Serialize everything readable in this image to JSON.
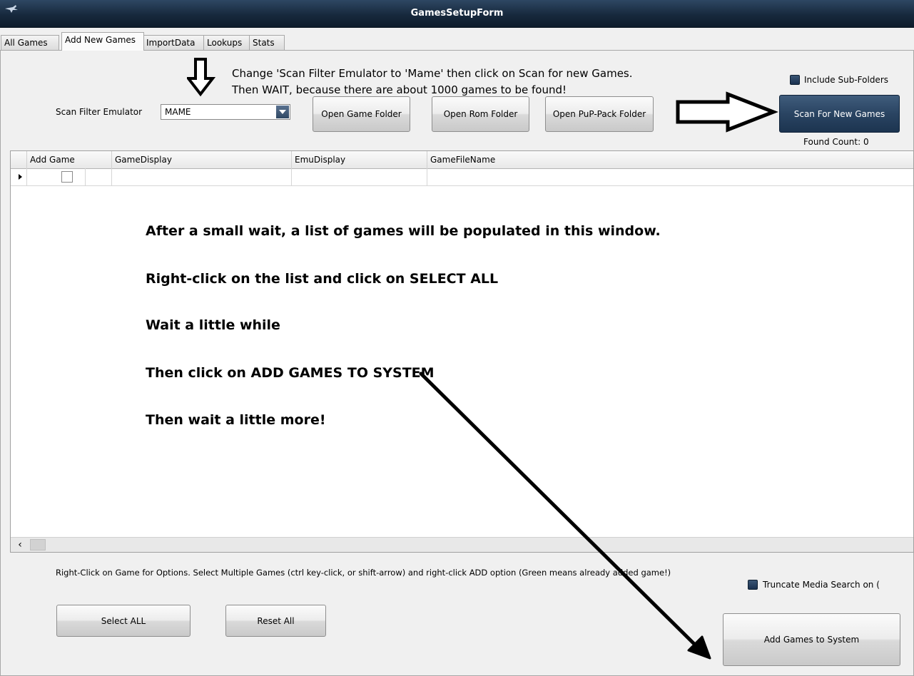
{
  "window": {
    "title": "GamesSetupForm"
  },
  "tabs": [
    {
      "label": "All Games"
    },
    {
      "label": "Add New Games"
    },
    {
      "label": "ImportData"
    },
    {
      "label": "Lookups"
    },
    {
      "label": "Stats"
    }
  ],
  "instructions_top": {
    "line1": "Change 'Scan Filter Emulator to 'Mame' then click on Scan for new Games.",
    "line2": "Then WAIT, because there are about 1000 games to be found!"
  },
  "scan_filter": {
    "label": "Scan Filter Emulator",
    "value": "MAME"
  },
  "buttons": {
    "open_game_folder": "Open Game Folder",
    "open_rom_folder": "Open Rom Folder",
    "open_puppack_folder": "Open PuP-Pack Folder",
    "scan_for_new_games": "Scan For New Games",
    "select_all": "Select ALL",
    "reset_all": "Reset All",
    "add_games_to_system": "Add Games to System"
  },
  "include_subfolders": {
    "label": "Include Sub-Folders",
    "checked": true
  },
  "found_count": "Found Count: 0",
  "grid": {
    "columns": [
      "Add Game",
      "GameDisplay",
      "EmuDisplay",
      "GameFileName"
    ]
  },
  "instructions_grid": [
    "After a small wait, a list of games will be populated in this window.",
    "Right-click on the list and click on SELECT ALL",
    "Wait a little while",
    "Then click on ADD GAMES TO SYSTEM",
    "Then wait a little more!"
  ],
  "options_hint": "Right-Click on Game for Options.  Select Multiple Games (ctrl key-click, or shift-arrow) and right-click ADD option (Green means already added game!)",
  "truncate_media": {
    "label": "Truncate Media Search on (",
    "checked": true
  },
  "colors": {
    "titlebar": "#17293d",
    "accent_button": "#2a4462",
    "annotation_arrow": "#000000"
  }
}
